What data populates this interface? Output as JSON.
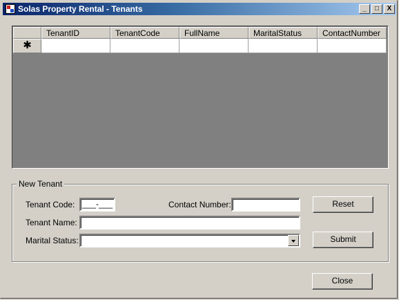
{
  "window": {
    "title": "Solas Property Rental - Tenants",
    "controls": {
      "minimize": "_",
      "maximize": "□",
      "close": "X"
    }
  },
  "grid": {
    "columns": [
      "TenantID",
      "TenantCode",
      "FullName",
      "MaritalStatus",
      "ContactNumber"
    ],
    "new_row_marker": "✱"
  },
  "new_tenant": {
    "legend": "New Tenant",
    "tenant_code_label": "Tenant Code:",
    "tenant_code_mask": "___-___",
    "contact_number_label": "Contact Number:",
    "contact_number_value": "",
    "tenant_name_label": "Tenant Name:",
    "tenant_name_value": "",
    "marital_status_label": "Marital Status:",
    "marital_status_value": ""
  },
  "buttons": {
    "reset": "Reset",
    "submit": "Submit",
    "close": "Close"
  }
}
